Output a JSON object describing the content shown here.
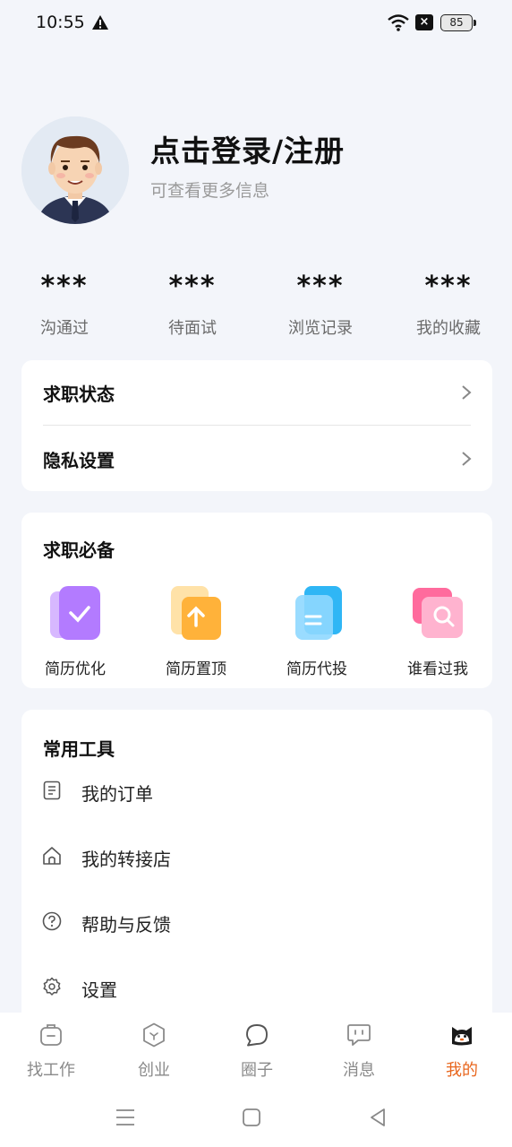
{
  "status": {
    "time": "10:55",
    "battery": "85",
    "alert_icon": "warning-icon",
    "x_icon": "close-box-icon"
  },
  "profile": {
    "title": "点击登录/注册",
    "subtitle": "可查看更多信息",
    "avatar_icon": "avatar-man-icon"
  },
  "stats": [
    {
      "value": "***",
      "label": "沟通过"
    },
    {
      "value": "***",
      "label": "待面试"
    },
    {
      "value": "***",
      "label": "浏览记录"
    },
    {
      "value": "***",
      "label": "我的收藏"
    }
  ],
  "menu": [
    {
      "label": "求职状态"
    },
    {
      "label": "隐私设置"
    }
  ],
  "essentials": {
    "title": "求职必备",
    "items": [
      {
        "label": "简历优化",
        "icon": "resume-optimize-icon"
      },
      {
        "label": "简历置顶",
        "icon": "resume-top-icon"
      },
      {
        "label": "简历代投",
        "icon": "resume-delivery-icon"
      },
      {
        "label": "谁看过我",
        "icon": "who-viewed-me-icon"
      }
    ]
  },
  "tools": {
    "title": "常用工具",
    "items": [
      {
        "label": "我的订单",
        "icon": "order-icon"
      },
      {
        "label": "我的转接店",
        "icon": "shop-icon"
      },
      {
        "label": "帮助与反馈",
        "icon": "help-icon"
      },
      {
        "label": "设置",
        "icon": "gear-icon"
      }
    ]
  },
  "tabs": [
    {
      "label": "找工作",
      "icon": "briefcase-icon"
    },
    {
      "label": "创业",
      "icon": "startup-icon"
    },
    {
      "label": "圈子",
      "icon": "chat-bubble-icon"
    },
    {
      "label": "消息",
      "icon": "message-icon"
    },
    {
      "label": "我的",
      "icon": "cat-profile-icon",
      "active": true
    }
  ],
  "colors": {
    "accent": "#e8661d",
    "background": "#f3f5fa"
  }
}
